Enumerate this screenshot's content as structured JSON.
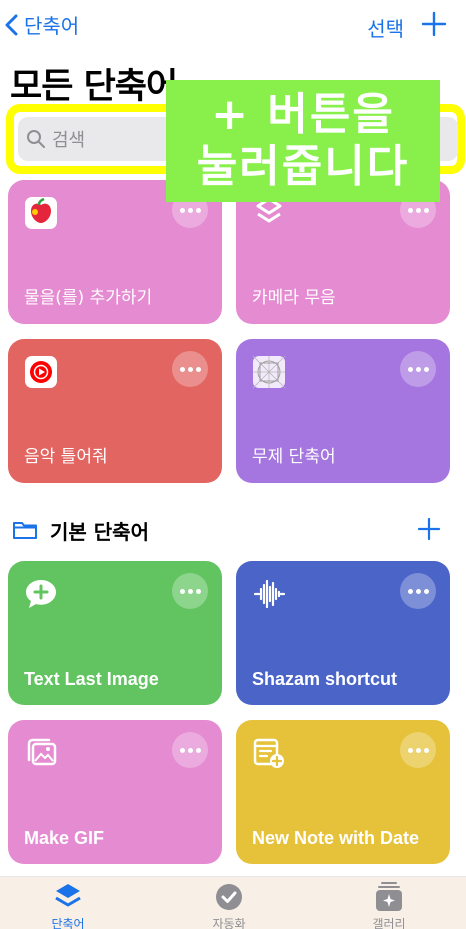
{
  "nav": {
    "back_label": "단축어",
    "select_label": "선택"
  },
  "page_title": "모든 단축어",
  "search": {
    "placeholder": "검색"
  },
  "overlay": {
    "line1": "+ 버튼을",
    "line2": "눌러줍니다"
  },
  "cards_top": [
    {
      "label": "물을(를) 추가하기",
      "color": "#e58bd1",
      "icon": "apple-health-icon"
    },
    {
      "label": "카메라 무음",
      "color": "#e58bd1",
      "icon": "layers-shortcut-icon"
    },
    {
      "label": "음악 틀어줘",
      "color": "#e26561",
      "icon": "youtube-music-icon"
    },
    {
      "label": "무제 단축어",
      "color": "#a676e0",
      "icon": "placeholder-grid-icon"
    }
  ],
  "section": {
    "title": "기본 단축어"
  },
  "cards_bottom": [
    {
      "label": "Text Last Image",
      "color": "#62c461",
      "icon": "message-plus-icon"
    },
    {
      "label": "Shazam shortcut",
      "color": "#4a64c8",
      "icon": "waveform-icon"
    },
    {
      "label": "Make GIF",
      "color": "#e58bd1",
      "icon": "photos-icon"
    },
    {
      "label": "New Note with Date",
      "color": "#e6c23a",
      "icon": "note-add-icon"
    }
  ],
  "tabs": [
    {
      "label": "단축어",
      "active": true,
      "color": "#1a73e8"
    },
    {
      "label": "자동화",
      "active": false,
      "color": "#8e8e93"
    },
    {
      "label": "갤러리",
      "active": false,
      "color": "#8e8e93"
    }
  ]
}
